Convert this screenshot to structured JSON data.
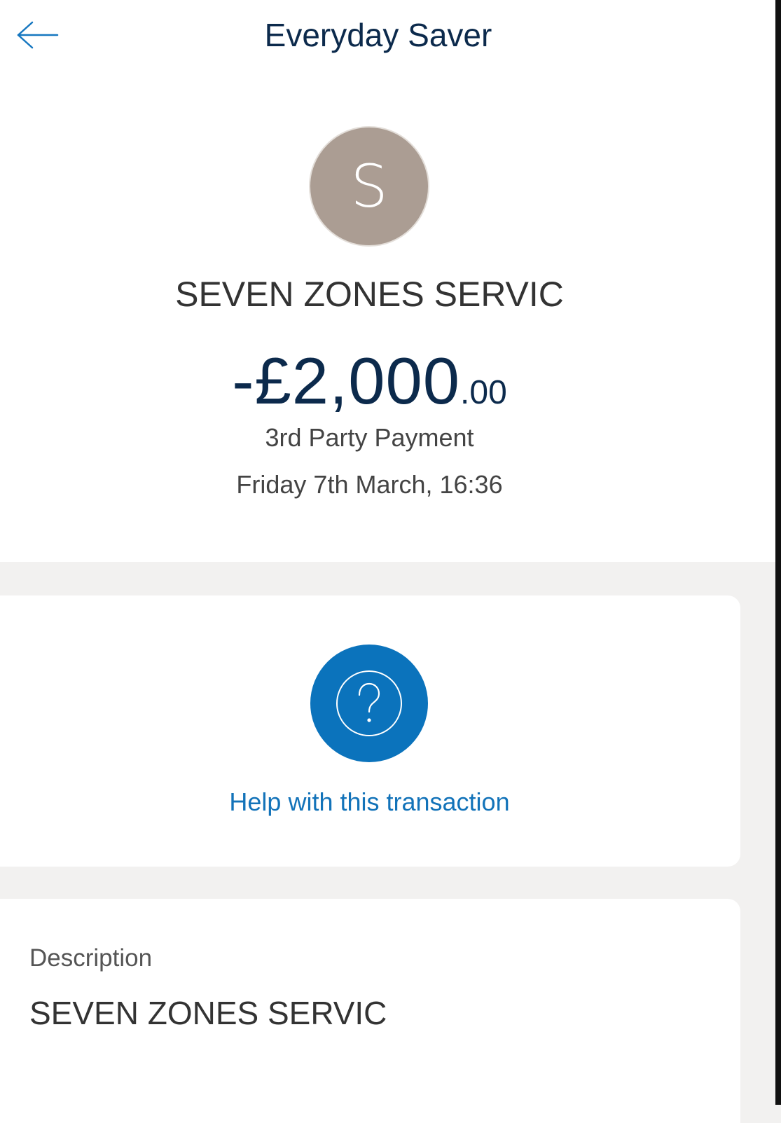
{
  "header": {
    "title": "Everyday Saver",
    "back_icon": "arrow-left-icon"
  },
  "colors": {
    "brand_blue": "#0b73bc",
    "navy_text": "#0c2a4c",
    "avatar_bg": "#ab9d93",
    "page_bg": "#f2f1f0",
    "link_blue": "#1373b9"
  },
  "transaction": {
    "avatar_initial": "S",
    "merchant": "SEVEN ZONES SERVIC",
    "amount_major": "-£2,000",
    "amount_minor": ".00",
    "type": "3rd Party Payment",
    "datetime": "Friday 7th March, 16:36"
  },
  "help": {
    "icon": "question-circle-icon",
    "label": "Help with this transaction"
  },
  "description": {
    "label": "Description",
    "value": "SEVEN ZONES SERVIC"
  }
}
